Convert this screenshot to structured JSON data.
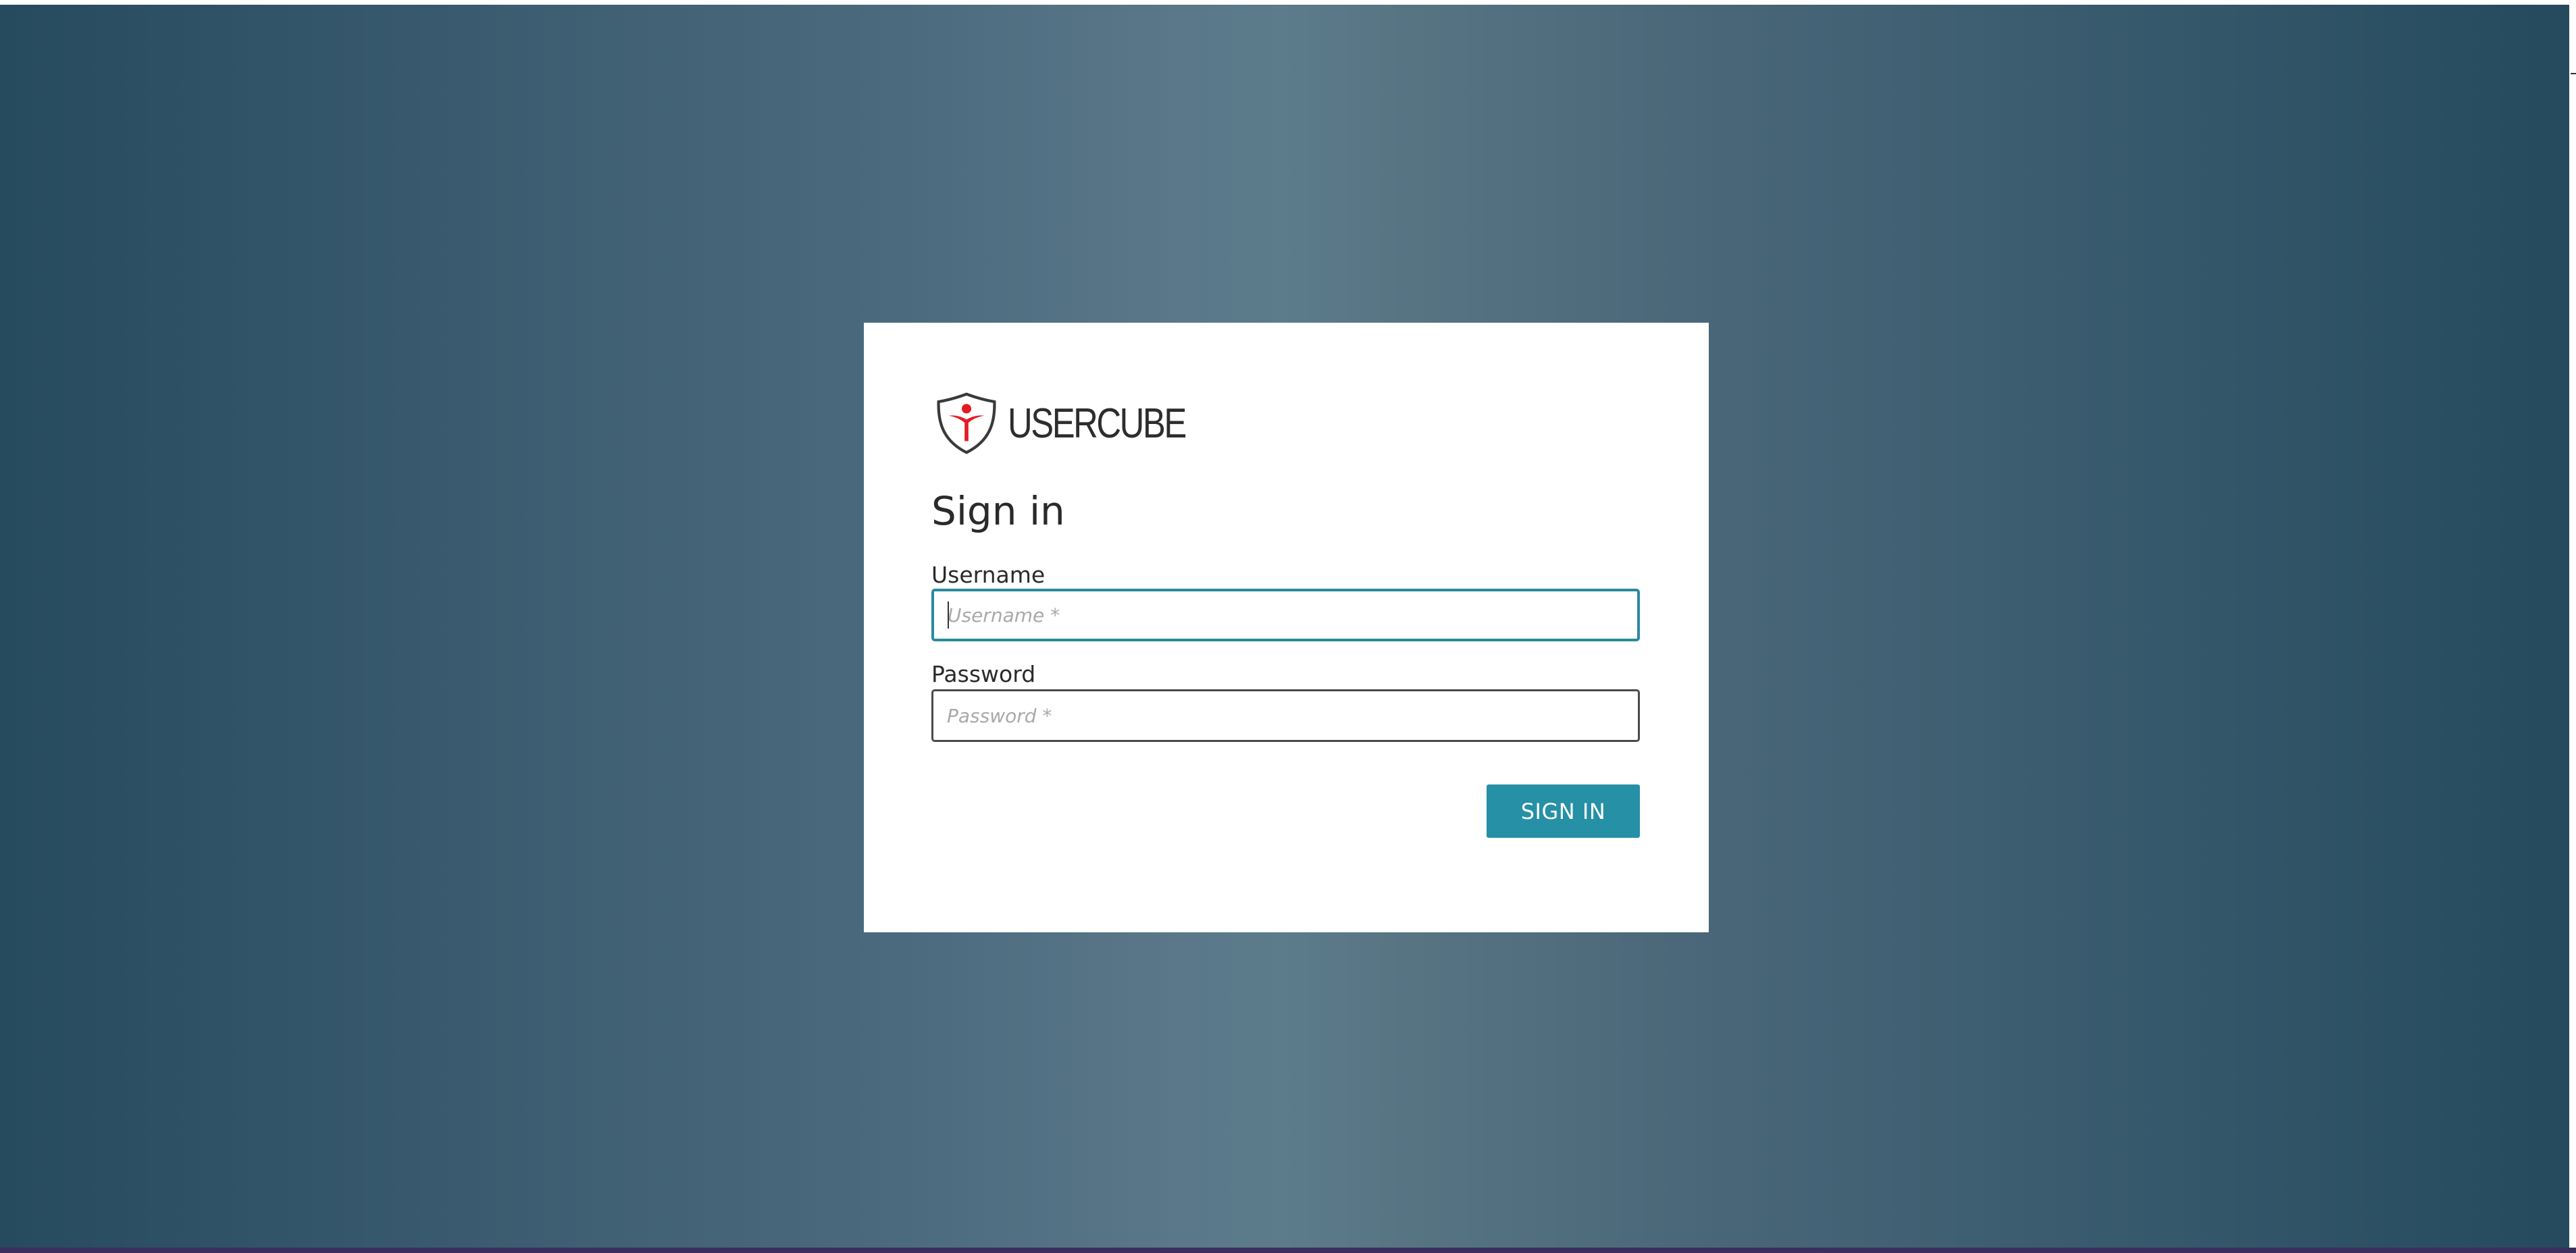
{
  "brand": {
    "name": "USERCUBE",
    "logo_icon": "usercube-shield-icon",
    "accent_color": "#e31b23"
  },
  "signin": {
    "title": "Sign in",
    "username_label": "Username",
    "username_placeholder": "Username *",
    "password_label": "Password",
    "password_placeholder": "Password *",
    "submit_label": "SIGN IN",
    "button_color": "#2590a6",
    "focus_color": "#2a8a9e"
  },
  "background": {
    "gradient_colors": [
      "#264a5e",
      "#5c7b8b",
      "#254a5d"
    ]
  }
}
